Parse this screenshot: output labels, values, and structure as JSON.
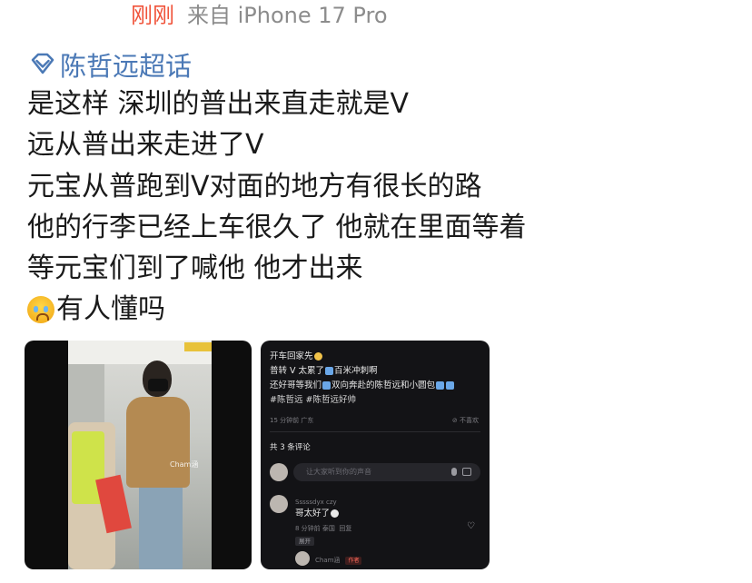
{
  "post": {
    "time": "刚刚",
    "source": "来自 iPhone 17 Pro",
    "topic": "陈哲远超话",
    "lines": [
      "是这样 深圳的普出来直走就是V",
      "远从普出来走进了V",
      "元宝从普跑到V对面的地方有很长的路",
      "他的行李已经上车很久了 他就在里面等着",
      "等元宝们到了喊他 他才出来",
      "有人懂吗"
    ],
    "emoji_icon": "crying-face-emoji",
    "colors": {
      "time": "#f0533a",
      "source": "#8c8c8c",
      "topic": "#4b79b6",
      "text": "#1a1a1a"
    }
  },
  "image1": {
    "watermark": "Cham涵"
  },
  "image2": {
    "line1": "开车回家先",
    "line2a": "普转 V 太累了",
    "line2b": "百米冲刺啊",
    "line3a": "还好哥等我们",
    "line3b": "双向奔赴的陈哲远和小圆包",
    "hashtags": "#陈哲远 #陈哲远好帅",
    "meta": "15 分钟前 广东",
    "dislike": "不喜欢",
    "comments_count": "共 3 条评论",
    "input_placeholder": "让大家听到你的声音",
    "c1_user": "Sssssdyx czy",
    "c1_text": "哥太好了",
    "c1_meta": "8 分钟前 泰国",
    "c1_reply": "回复",
    "c1_expand": "展开",
    "c2_user": "Cham涵",
    "c2_badge": "作者"
  }
}
